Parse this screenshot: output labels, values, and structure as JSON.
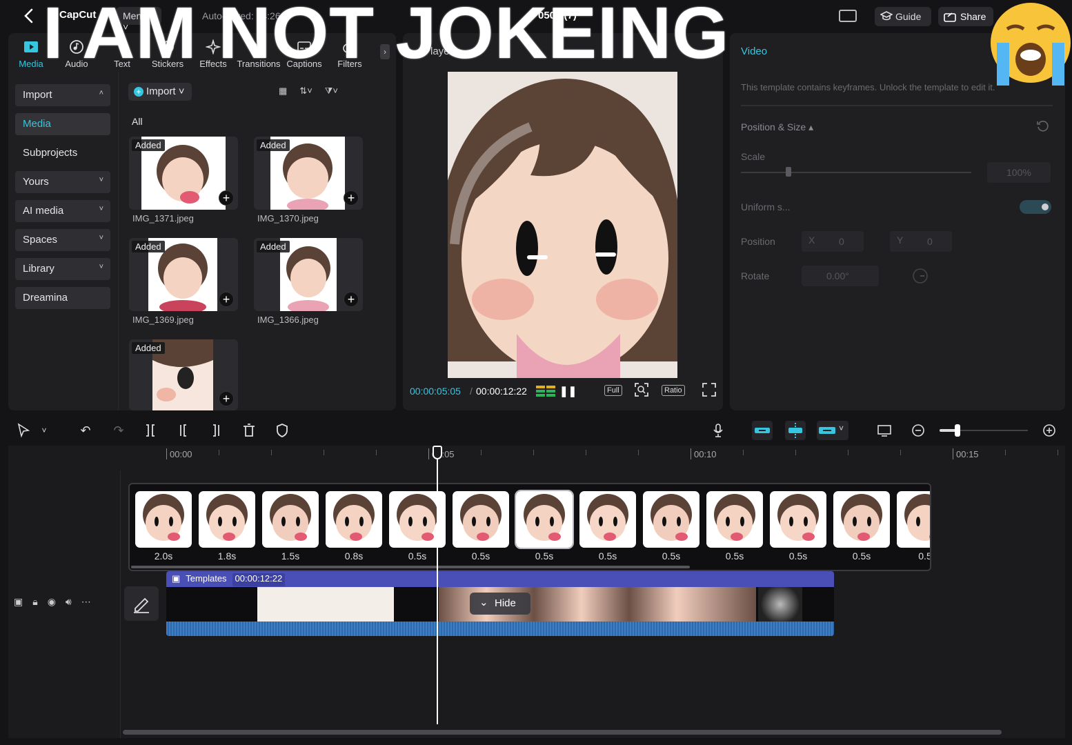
{
  "topbar": {
    "logo": "CapCut",
    "menu_label": "Menu",
    "autosave": "Auto-saved: 14:26",
    "project_title": "0506 (7)",
    "guide_label": "Guide",
    "share_label": "Share"
  },
  "categories": [
    {
      "label": "Media",
      "icon": "media-icon",
      "active": true
    },
    {
      "label": "Audio",
      "icon": "audio-icon"
    },
    {
      "label": "Text",
      "icon": "text-icon"
    },
    {
      "label": "Stickers",
      "icon": "sticker-icon"
    },
    {
      "label": "Effects",
      "icon": "effects-icon"
    },
    {
      "label": "Transitions",
      "icon": "transition-icon"
    },
    {
      "label": "Captions",
      "icon": "caption-icon"
    },
    {
      "label": "Filters",
      "icon": "filter-icon"
    }
  ],
  "sidenav": [
    {
      "label": "Import",
      "chevron": "˄"
    },
    {
      "label": "Media",
      "active": true
    },
    {
      "label": "Subprojects",
      "plain": true
    },
    {
      "label": "Yours",
      "chevron": "˅"
    },
    {
      "label": "AI media",
      "chevron": "˅"
    },
    {
      "label": "Spaces",
      "chevron": "˅"
    },
    {
      "label": "Library",
      "chevron": "˅"
    },
    {
      "label": "Dreamina"
    }
  ],
  "media": {
    "import_label": "Import",
    "filter_label": "All",
    "items": [
      {
        "name": "IMG_1371.jpeg",
        "badge": "Added"
      },
      {
        "name": "IMG_1370.jpeg",
        "badge": "Added"
      },
      {
        "name": "IMG_1369.jpeg",
        "badge": "Added"
      },
      {
        "name": "IMG_1366.jpeg",
        "badge": "Added"
      },
      {
        "name": "",
        "badge": "Added"
      }
    ]
  },
  "player": {
    "title": "Player",
    "current_time": "00:00:05:05",
    "total_time": "00:00:12:22",
    "full_label": "Full",
    "ratio_label": "Ratio"
  },
  "properties": {
    "tab": "Video",
    "note": "This template contains keyframes. Unlock the template to edit it.",
    "section": "Position & Size",
    "scale_label": "Scale",
    "scale_value": "100%",
    "uniform_label": "Uniform s...",
    "position_label": "Position",
    "x_label": "X",
    "x_value": "0",
    "y_label": "Y",
    "y_value": "0",
    "rotate_label": "Rotate",
    "rotate_value": "0.00°"
  },
  "timeline": {
    "ruler": [
      "00:00",
      "00:05",
      "00:10",
      "00:15"
    ],
    "clips": [
      "2.0s",
      "1.8s",
      "1.5s",
      "0.8s",
      "0.5s",
      "0.5s",
      "0.5s",
      "0.5s",
      "0.5s",
      "0.5s",
      "0.5s",
      "0.5s",
      "0.5"
    ],
    "template_label": "Templates",
    "template_duration": "00:00:12:22",
    "hide_label": "Hide",
    "zoom_level": 0.2
  },
  "overlay": {
    "caption": "I AM NOT JOKEING",
    "emoji": "loudly-crying-face-emoji"
  },
  "colors": {
    "accent": "#37c6e0",
    "template_track": "#4a4fb8",
    "background": "#141416"
  }
}
